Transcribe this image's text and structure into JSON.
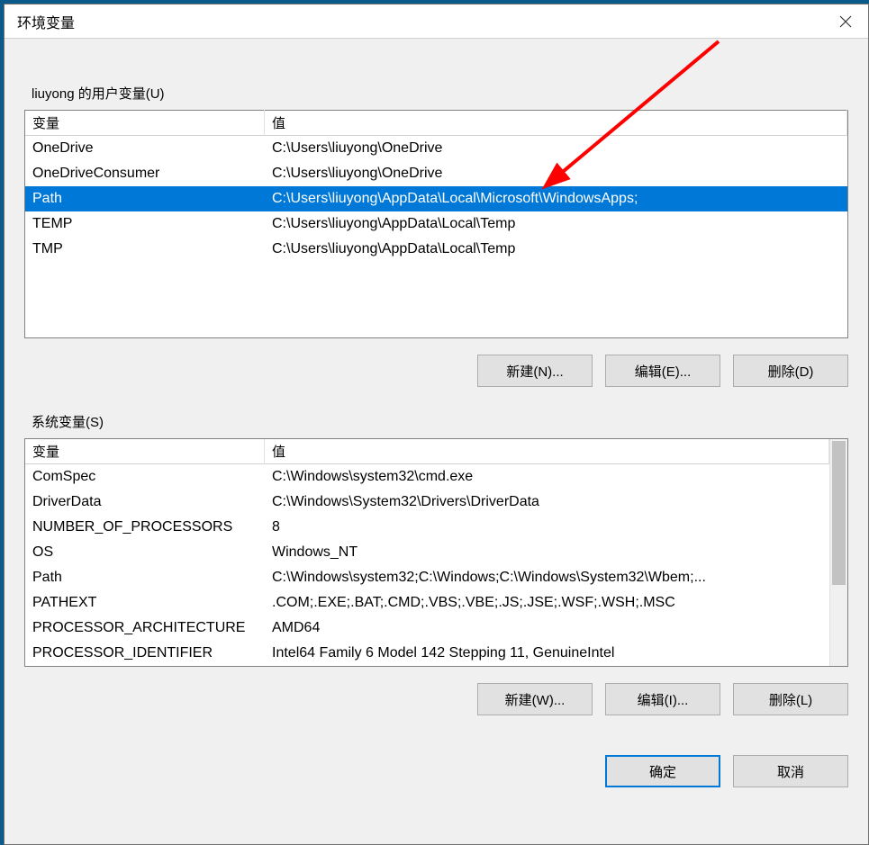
{
  "window": {
    "title": "环境变量"
  },
  "user_section": {
    "label": "liuyong 的用户变量(U)",
    "headers": {
      "var": "变量",
      "val": "值"
    },
    "rows": [
      {
        "var": "OneDrive",
        "val": "C:\\Users\\liuyong\\OneDrive",
        "selected": false
      },
      {
        "var": "OneDriveConsumer",
        "val": "C:\\Users\\liuyong\\OneDrive",
        "selected": false
      },
      {
        "var": "Path",
        "val": "C:\\Users\\liuyong\\AppData\\Local\\Microsoft\\WindowsApps;",
        "selected": true
      },
      {
        "var": "TEMP",
        "val": "C:\\Users\\liuyong\\AppData\\Local\\Temp",
        "selected": false
      },
      {
        "var": "TMP",
        "val": "C:\\Users\\liuyong\\AppData\\Local\\Temp",
        "selected": false
      }
    ],
    "buttons": {
      "new": "新建(N)...",
      "edit": "编辑(E)...",
      "del": "删除(D)"
    }
  },
  "sys_section": {
    "label": "系统变量(S)",
    "headers": {
      "var": "变量",
      "val": "值"
    },
    "rows": [
      {
        "var": "ComSpec",
        "val": "C:\\Windows\\system32\\cmd.exe"
      },
      {
        "var": "DriverData",
        "val": "C:\\Windows\\System32\\Drivers\\DriverData"
      },
      {
        "var": "NUMBER_OF_PROCESSORS",
        "val": "8"
      },
      {
        "var": "OS",
        "val": "Windows_NT"
      },
      {
        "var": "Path",
        "val": "C:\\Windows\\system32;C:\\Windows;C:\\Windows\\System32\\Wbem;..."
      },
      {
        "var": "PATHEXT",
        "val": ".COM;.EXE;.BAT;.CMD;.VBS;.VBE;.JS;.JSE;.WSF;.WSH;.MSC"
      },
      {
        "var": "PROCESSOR_ARCHITECTURE",
        "val": "AMD64"
      },
      {
        "var": "PROCESSOR_IDENTIFIER",
        "val": "Intel64 Family 6 Model 142 Stepping 11, GenuineIntel"
      }
    ],
    "buttons": {
      "new": "新建(W)...",
      "edit": "编辑(I)...",
      "del": "删除(L)"
    }
  },
  "footer": {
    "ok": "确定",
    "cancel": "取消"
  },
  "annotation": {
    "arrow_color": "#ff0000"
  }
}
